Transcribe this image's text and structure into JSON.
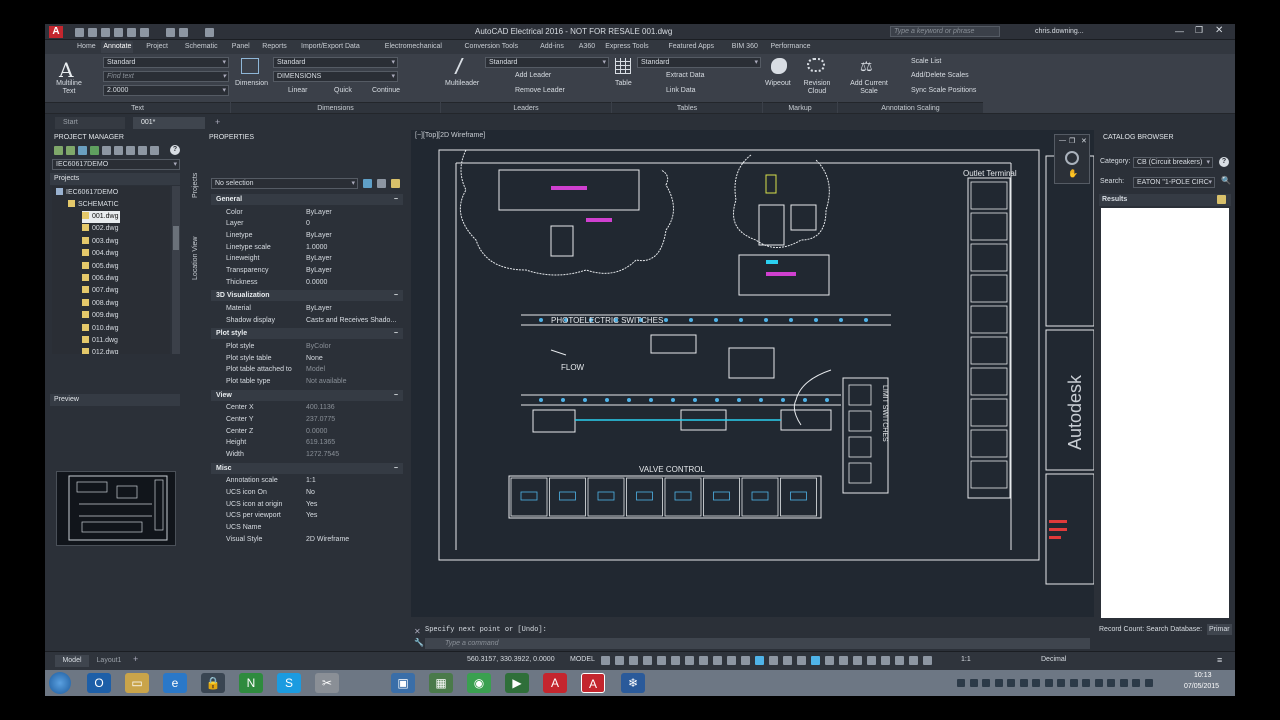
{
  "app": {
    "title": "AutoCAD Electrical 2016 - NOT FOR RESALE   001.dwg",
    "search_placeholder": "Type a keyword or phrase",
    "user": "chris.downing..."
  },
  "ribbon_tabs": [
    "Home",
    "Annotate",
    "Project",
    "Schematic",
    "Panel",
    "Reports",
    "Import/Export Data",
    "Electromechanical",
    "Conversion Tools",
    "Add-ins",
    "A360",
    "Express Tools",
    "Featured Apps",
    "BIM 360",
    "Performance"
  ],
  "ribbon": {
    "text_panel": {
      "title": "Text",
      "multiline_text": "Multiline Text",
      "style": "Standard",
      "find_placeholder": "Find text",
      "height": "2.0000"
    },
    "dimensions_panel": {
      "title": "Dimensions",
      "dimension": "Dimension",
      "style": "Standard",
      "dimensions_layer": "DIMENSIONS",
      "linear": "Linear",
      "quick": "Quick",
      "continue": "Continue"
    },
    "leaders_panel": {
      "title": "Leaders",
      "multileader": "Multileader",
      "style": "Standard",
      "add_leader": "Add Leader",
      "remove_leader": "Remove Leader"
    },
    "tables_panel": {
      "title": "Tables",
      "table": "Table",
      "style": "Standard",
      "extract_data": "Extract Data",
      "link_data": "Link Data"
    },
    "markup_panel": {
      "title": "Markup",
      "wipeout": "Wipeout",
      "revision_cloud": "Revision Cloud"
    },
    "scaling_panel": {
      "title": "Annotation Scaling",
      "add_current_scale": "Add Current Scale",
      "scale_list": "Scale List",
      "add_delete_scales": "Add/Delete Scales",
      "sync_scale_positions": "Sync Scale Positions"
    }
  },
  "doc_tabs": [
    "Start",
    "001*"
  ],
  "project_manager": {
    "title": "PROJECT MANAGER",
    "project_select": "IEC60617DEMO",
    "projects_label": "Projects",
    "root": "IEC60617DEMO",
    "folder": "SCHEMATIC",
    "files": [
      "001.dwg",
      "002.dwg",
      "003.dwg",
      "004.dwg",
      "005.dwg",
      "006.dwg",
      "007.dwg",
      "008.dwg",
      "009.dwg",
      "010.dwg",
      "011.dwg",
      "012.dwg"
    ],
    "side_tabs": [
      "Projects",
      "Location View"
    ],
    "preview_label": "Preview"
  },
  "properties": {
    "title": "PROPERTIES",
    "selection": "No selection",
    "sections": {
      "general": {
        "title": "General",
        "rows": [
          [
            "Color",
            "ByLayer"
          ],
          [
            "Layer",
            "0"
          ],
          [
            "Linetype",
            "ByLayer"
          ],
          [
            "Linetype scale",
            "1.0000"
          ],
          [
            "Lineweight",
            "ByLayer"
          ],
          [
            "Transparency",
            "ByLayer"
          ],
          [
            "Thickness",
            "0.0000"
          ]
        ]
      },
      "viz3d": {
        "title": "3D Visualization",
        "rows": [
          [
            "Material",
            "ByLayer"
          ],
          [
            "Shadow display",
            "Casts and Receives Shado..."
          ]
        ]
      },
      "plot": {
        "title": "Plot style",
        "rows": [
          [
            "Plot style",
            "ByColor"
          ],
          [
            "Plot style table",
            "None"
          ],
          [
            "Plot table attached to",
            "Model"
          ],
          [
            "Plot table type",
            "Not available"
          ]
        ]
      },
      "view": {
        "title": "View",
        "rows": [
          [
            "Center X",
            "400.1136"
          ],
          [
            "Center Y",
            "237.0775"
          ],
          [
            "Center Z",
            "0.0000"
          ],
          [
            "Height",
            "619.1365"
          ],
          [
            "Width",
            "1272.7545"
          ]
        ]
      },
      "misc": {
        "title": "Misc",
        "rows": [
          [
            "Annotation scale",
            "1:1"
          ],
          [
            "UCS icon On",
            "No"
          ],
          [
            "UCS icon at origin",
            "Yes"
          ],
          [
            "UCS per viewport",
            "Yes"
          ],
          [
            "UCS Name",
            ""
          ],
          [
            "Visual Style",
            "2D Wireframe"
          ]
        ]
      }
    }
  },
  "viewport": {
    "label": "[−][Top][2D Wireframe]",
    "drawing": {
      "photoelectric": "PHOTOELECTRIC SWITCHES",
      "flow": "FLOW",
      "valve_control": "VALVE CONTROL",
      "outlet_terminal": "Outlet Terminal",
      "limit_switches": "LIMIT SWITCHES"
    },
    "watermark": "Autodesk"
  },
  "command": {
    "history": "Specify next point or [Undo]:",
    "placeholder": "Type a command"
  },
  "catalog": {
    "title": "CATALOG BROWSER",
    "category_label": "Category:",
    "category_value": "CB (Circuit breakers)",
    "search_label": "Search:",
    "search_value": "EATON \"1-POLE CIRC",
    "results_label": "Results",
    "record_count": "Record Count: Search Database:",
    "primary": "Primar"
  },
  "statusbar": {
    "model_tab": "Model",
    "layout_tab": "Layout1",
    "coords": "560.3157, 330.3922, 0.0000",
    "model": "MODEL",
    "scale": "1:1",
    "units": "Decimal"
  },
  "taskbar": {
    "time": "10:13",
    "date": "07/05/2015"
  },
  "colors": {
    "accent": "#4fb3e8",
    "title_bg": "#2d3139",
    "panel_bg": "#2b3038",
    "viewport_bg": "#212831"
  }
}
